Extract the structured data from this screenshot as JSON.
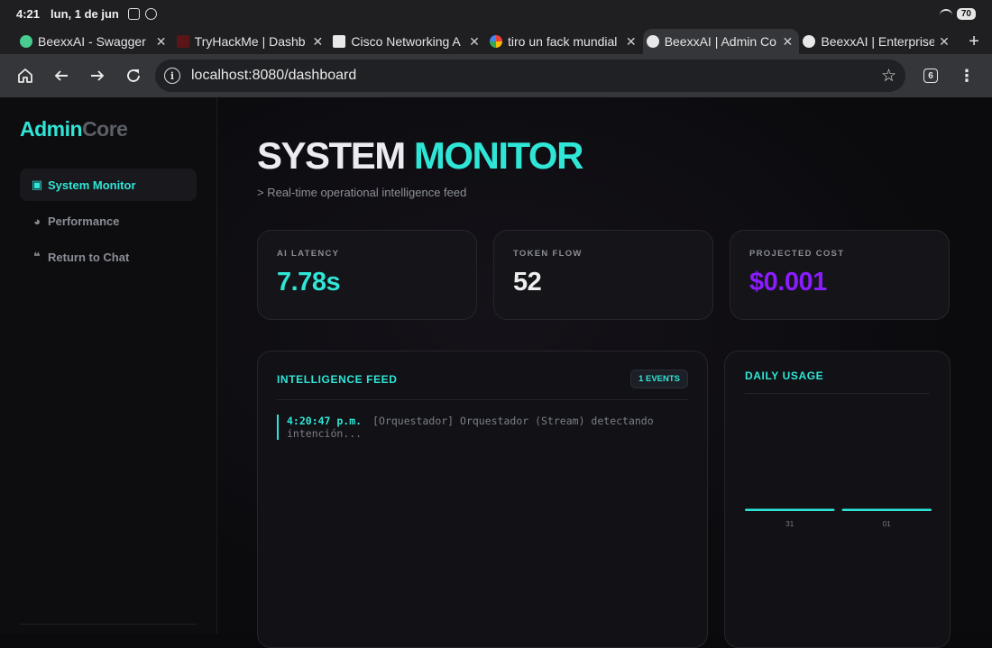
{
  "status_bar": {
    "time": "4:21",
    "date": "lun, 1 de jun",
    "battery": "70"
  },
  "tabs": [
    {
      "label": "BeexxAI - Swagger",
      "favicon_color": "#49cc90",
      "active": false
    },
    {
      "label": "TryHackMe | Dashb",
      "favicon_color": "#7a1a1a",
      "active": false
    },
    {
      "label": "Cisco Networking A",
      "favicon_color": "#e8e8e8",
      "active": false
    },
    {
      "label": "tiro un fack mundial",
      "favicon_color": "#4285f4",
      "active": false
    },
    {
      "label": "BeexxAI | Admin Co",
      "favicon_color": "#e8e8e8",
      "active": true
    },
    {
      "label": "BeexxAI | Enterprise",
      "favicon_color": "#e8e8e8",
      "active": false
    }
  ],
  "toolbar": {
    "url": "localhost:8080/dashboard",
    "tab_count": "6"
  },
  "sidebar": {
    "brand_a": "Admin",
    "brand_b": "Core",
    "items": [
      {
        "label": "System Monitor",
        "icon": "chip-icon",
        "active": true
      },
      {
        "label": "Performance",
        "icon": "pie-chart-icon",
        "active": false
      },
      {
        "label": "Return to Chat",
        "icon": "chat-bubbles-icon",
        "active": false
      }
    ]
  },
  "page": {
    "title_a": "SYSTEM",
    "title_b": "MONITOR",
    "subtitle": "> Real-time operational intelligence feed"
  },
  "metrics": [
    {
      "label": "AI LATENCY",
      "value": "7.78s",
      "color": "#2fe6d6"
    },
    {
      "label": "TOKEN FLOW",
      "value": "52",
      "color": "#eeeeee"
    },
    {
      "label": "PROJECTED COST",
      "value": "$0.001",
      "color": "#8a1cff"
    }
  ],
  "feed": {
    "title": "INTELLIGENCE FEED",
    "badge": "1 EVENTS",
    "entries": [
      {
        "time": "4:20:47 p.m.",
        "text": "[Orquestador] Orquestador (Stream) detectando intención..."
      }
    ]
  },
  "usage": {
    "title": "DAILY USAGE"
  },
  "chart_data": {
    "type": "bar",
    "categories": [
      "31",
      "01"
    ],
    "values": [
      0,
      0
    ],
    "title": "DAILY USAGE",
    "color": "#2fe6d6"
  }
}
